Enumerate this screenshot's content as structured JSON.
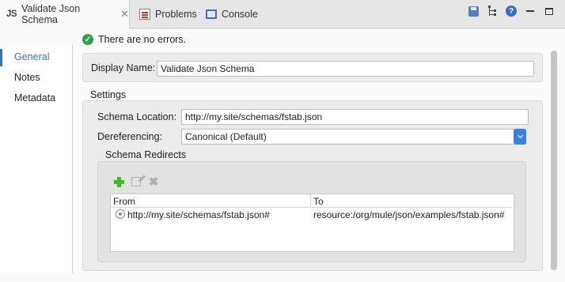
{
  "tabs": [
    {
      "icon": "js-file-icon",
      "icon_text": "JS",
      "label": "Validate Json Schema",
      "active": true,
      "closable": true
    },
    {
      "icon": "problems-icon",
      "label": "Problems",
      "active": false
    },
    {
      "icon": "console-icon",
      "label": "Console",
      "active": false
    }
  ],
  "toolbar": {
    "icons": [
      "save-icon",
      "tree-structure-icon",
      "help-icon",
      "minimize-icon",
      "maximize-icon"
    ],
    "help_glyph": "?",
    "close_glyph": "✕"
  },
  "status": {
    "icon": "check-icon",
    "text": "There are no errors."
  },
  "nav": {
    "items": [
      {
        "label": "General",
        "active": true
      },
      {
        "label": "Notes",
        "active": false
      },
      {
        "label": "Metadata",
        "active": false
      }
    ]
  },
  "form": {
    "display_name_label": "Display Name:",
    "display_name_value": "Validate Json Schema",
    "settings_title": "Settings",
    "schema_location_label": "Schema Location:",
    "schema_location_value": "http://my.site/schemas/fstab.json",
    "dereferencing_label": "Dereferencing:",
    "dereferencing_value": "Canonical (Default)",
    "redirects_title": "Schema Redirects"
  },
  "redirects_table": {
    "tools": [
      "add-icon",
      "edit-icon",
      "delete-icon"
    ],
    "columns": [
      "From",
      "To"
    ],
    "rows": [
      {
        "from": "http://my.site/schemas/fstab.json#",
        "to": "resource:/org/mule/json/examples/fstab.json#"
      }
    ]
  },
  "colors": {
    "accent": "#3b73b9",
    "ok": "#2f9e44",
    "add": "#4caf3a",
    "select_button": "#3b82e0"
  }
}
